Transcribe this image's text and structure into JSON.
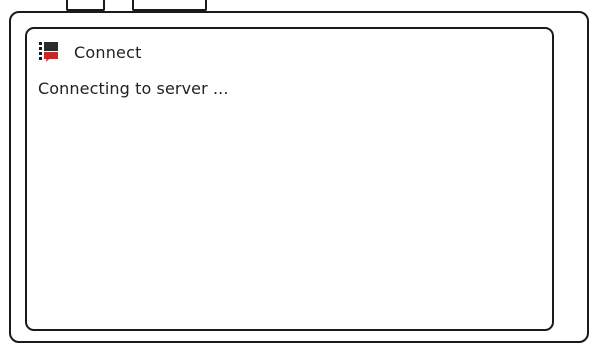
{
  "window": {
    "title": "Connect",
    "icon": "connect-app-icon",
    "accent_color": "#c62828"
  },
  "status": {
    "message": "Connecting to server ..."
  }
}
